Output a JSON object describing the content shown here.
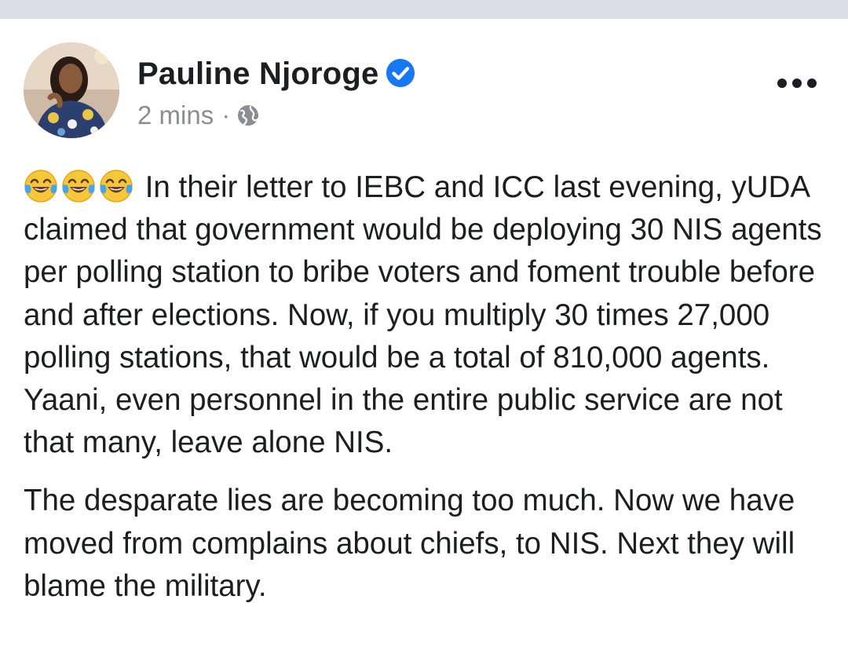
{
  "post": {
    "author": {
      "name": "Pauline Njoroge",
      "verified": true,
      "avatar": "profile-photo"
    },
    "timestamp": "2 mins",
    "separator": "·",
    "audience_icon": "globe-icon",
    "more_icon": "more-options-icon",
    "emojis": [
      "face-with-tears-of-joy",
      "face-with-tears-of-joy",
      "face-with-tears-of-joy"
    ],
    "paragraph_1": "In their letter to IEBC and ICC last evening, yUDA claimed that government would be deploying 30 NIS agents per polling station to bribe voters and foment trouble before and after elections. Now, if you multiply 30 times 27,000 polling stations, that would be a total of 810,000 agents. Yaani, even personnel in the entire public service are not that many, leave alone NIS.",
    "paragraph_2": "The desparate lies are becoming too much. Now we have moved from complains about chiefs, to NIS. Next they will blame the military."
  },
  "colors": {
    "text": "#1c1e21",
    "meta": "#8a8d91",
    "verified_badge": "#1877f2",
    "top_strip": "#dadde1"
  }
}
